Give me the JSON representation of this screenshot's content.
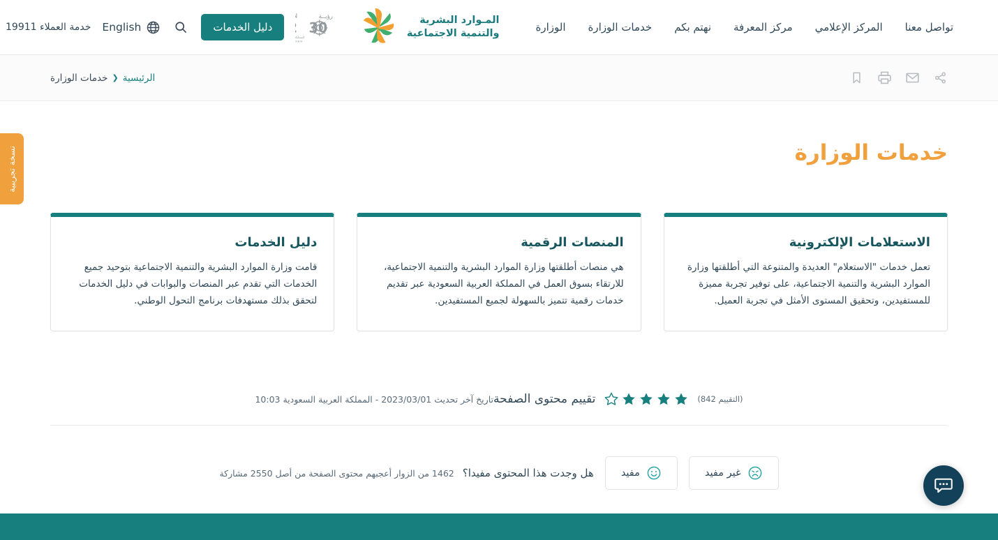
{
  "header": {
    "ministry_name_line1": "المـوارد البشرية",
    "ministry_name_line2": "والتنمية الاجتماعية",
    "nav": [
      {
        "label": "الوزارة",
        "name": "nav-ministry"
      },
      {
        "label": "خدمات الوزارة",
        "name": "nav-ministry-services"
      },
      {
        "label": "نهتم بكم",
        "name": "nav-we-care"
      },
      {
        "label": "مركز المعرفة",
        "name": "nav-knowledge-center"
      },
      {
        "label": "المركز الإعلامي",
        "name": "nav-media-center"
      },
      {
        "label": "تواصل معنا",
        "name": "nav-contact-us"
      }
    ],
    "customer_service": "خدمة العملاء 19911",
    "language_label": "English",
    "language_icon": "globe-icon",
    "search_icon": "search-icon",
    "guide_button": "دليل الخدمات",
    "vision_logo": {
      "word": "VISION",
      "word_ar": "رؤيــــة",
      "year": "2030",
      "kingdom_ar": "المملكة العربية السعودية",
      "kingdom_en": "KINGDOM OF SAUDI ARABIA"
    }
  },
  "breadcrumb": {
    "home": "الرئيسية",
    "separator": "❮",
    "current": "خدمات الوزارة"
  },
  "page_actions": [
    {
      "name": "share-icon",
      "title": "مشاركة"
    },
    {
      "name": "email-icon",
      "title": "بريد"
    },
    {
      "name": "print-icon",
      "title": "طباعة"
    },
    {
      "name": "bookmark-icon",
      "title": "حفظ"
    }
  ],
  "beta_tab": {
    "label": "نسخة تجريبية"
  },
  "main": {
    "page_title": "خدمات الوزارة",
    "cards": [
      {
        "title": "دليل الخدمات",
        "body": "قامت وزارة الموارد البشرية والتنمية الاجتماعية بتوحيد جميع الخدمات التي تقدم عبر المنصات والبوابات في دليل الخدمات لتحقق بذلك مستهدفات برنامج التحول الوطني."
      },
      {
        "title": "المنصات الرقمية",
        "body": "هي منصات أطلقتها وزارة الموارد البشرية والتنمية الاجتماعية، للارتقاء بسوق العمل في المملكة العربية السعودية عبر تقديم خدمات رقمية تتميز بالسهولة لجميع المستفيدين."
      },
      {
        "title": "الاستعلامات الإلكترونية",
        "body": "تعمل خدمات \"الاستعلام\" العديدة والمتنوعة التي أطلقتها وزارة الموارد البشرية والتنمية الاجتماعية، على توفير تجربة مميزة للمستفيدين، وتحقيق المستوى الأمثل في تجربة العميل."
      }
    ]
  },
  "rating": {
    "label": "تقييم محتوى الصفحة",
    "count_text": "(التقييم 842)",
    "filled_stars": 4,
    "total_stars": 5,
    "updated_text": "تاريخ آخر تحديث  2023/03/01  -  المملكة العربية السعودية 10:03"
  },
  "feedback": {
    "question": "هل وجدت هذا المحتوى مفيدا؟",
    "useful_label": "مفيد",
    "not_useful_label": "غير مفيد",
    "useful_icon": "smiley-face-icon",
    "not_useful_icon": "frowning-face-icon",
    "visitors_text": "1462 من الزوار أعجبهم محتوى الصفحة من أصل 2550 مشاركة"
  },
  "chat": {
    "icon": "chat-bubble-icon"
  },
  "colors": {
    "teal": "#17807f",
    "orange": "#f0a03c",
    "dark_navy": "#14415a",
    "title_orange": "#f0a03c",
    "card_title": "#17565f",
    "text": "#2f4858"
  }
}
